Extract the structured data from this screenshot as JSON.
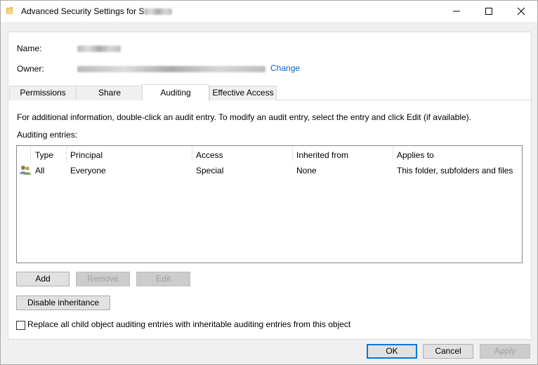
{
  "window": {
    "title": "Advanced Security Settings for S"
  },
  "header": {
    "name_label": "Name:",
    "owner_label": "Owner:",
    "change_link": "Change"
  },
  "tabs": [
    {
      "label": "Permissions"
    },
    {
      "label": "Share"
    },
    {
      "label": "Auditing",
      "active": true
    },
    {
      "label": "Effective Access"
    }
  ],
  "auditing": {
    "info_text": "For additional information, double-click an audit entry. To modify an audit entry, select the entry and click Edit (if available).",
    "entries_label": "Auditing entries:",
    "columns": [
      "Type",
      "Principal",
      "Access",
      "Inherited from",
      "Applies to"
    ],
    "rows": [
      {
        "type": "All",
        "principal": "Everyone",
        "access": "Special",
        "inherited_from": "None",
        "applies_to": "This folder, subfolders and files",
        "icon": "users-icon"
      }
    ],
    "add_button": "Add",
    "remove_button": "Remove",
    "edit_button": "Edit",
    "disable_inheritance_button": "Disable inheritance",
    "replace_checkbox_label": "Replace all child object auditing entries with inheritable auditing entries from this object",
    "replace_checked": false
  },
  "footer": {
    "ok_button": "OK",
    "cancel_button": "Cancel",
    "apply_button": "Apply"
  },
  "colors": {
    "link": "#0066cc",
    "default_button_border": "#0078d7",
    "folder_icon": "#e8b84a"
  }
}
